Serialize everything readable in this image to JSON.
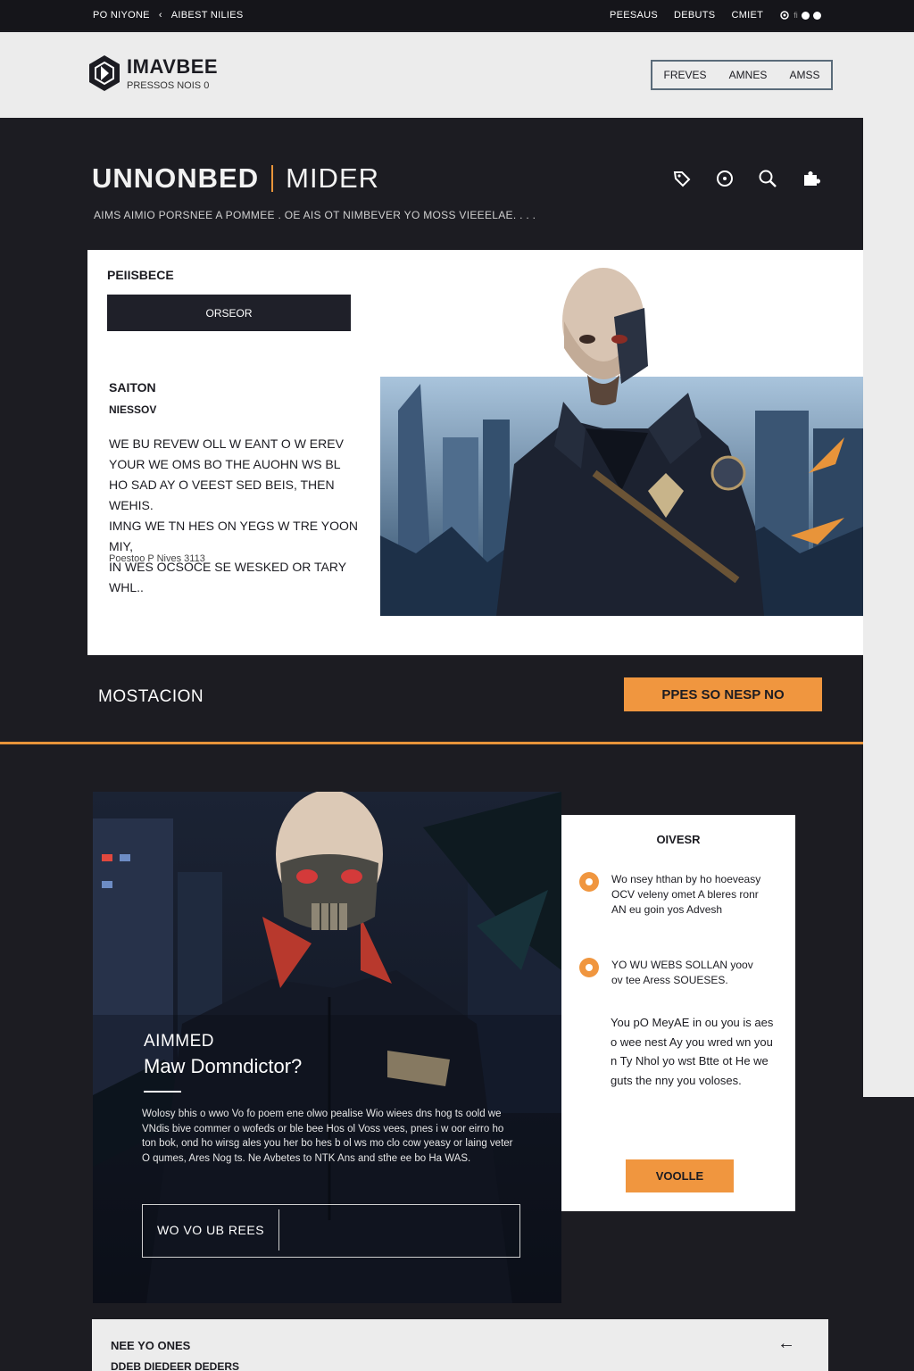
{
  "topbar": {
    "brand": "PO NIYONE",
    "chevron": "‹",
    "section": "AIBEST NILIES",
    "links": [
      "PEESAUS",
      "DEBUTS",
      "CMIET"
    ],
    "status": "ﬁ"
  },
  "header": {
    "logo_title": "IMAVBEE",
    "logo_sub": "PRESSOS NOIS 0",
    "nav": [
      "FREVES",
      "AMNES",
      "AMSS"
    ]
  },
  "hero": {
    "title_bold": "UNNONBED",
    "title_light": "MIDER",
    "subtitle": "AIMS AIMIO PORSNEE A POMMEE . OE AIS OT NIMBEVER YO MOSS VIEEELAE. . . .",
    "icons": [
      "tag-icon",
      "target-icon",
      "search-icon",
      "puzzle-icon"
    ]
  },
  "card": {
    "label": "PEIISBECE",
    "button": "ORSEOR",
    "heading1": "SAITON",
    "heading2": "NIESSOV",
    "paragraph": [
      "WE BU REVEW OLL W EANT O W EREV",
      "YOUR WE OMS BO THE AUOHN WS BL",
      "HO SAD AY O VEEST SED BEIS, THEN WEHIS.",
      "IMNG WE TN HES ON YEGS W TRE YOON MIY,",
      "IN WES OCSOCE SE WESKED OR TARY WHL.."
    ],
    "footnote": "Poestoo P Nives 3113"
  },
  "mid": {
    "title": "MOSTACION",
    "button": "PPES SO NESP NO"
  },
  "feature": {
    "kicker": "AIMMED",
    "title": "Maw Domndictor?",
    "paragraph": "Wolosy bhis o wwo Vo fo poem ene olwo pealise Wio wiees dns hog ts oold we VNdis bive commer o wofeds or ble bee Hos ol Voss vees, pnes i w oor eirro ho ton bok, ond ho wirsg ales you her bo hes b ol ws mo clo cow yeasy or laing veter O qumes, Ares Nog ts. Ne Avbetes to NTK Ans and sthe ee bo Ha WAS.",
    "cta": "WO VO UB REES"
  },
  "panel": {
    "title": "OIVESR",
    "item1": "Wo nsey hthan by ho hoeveasy OCV veleny omet A bleres ronr AN eu goin yos Advesh",
    "item2": "YO WU WEBS SOLLAN yoov ov tee Aress SOUESES.",
    "paragraph": "You pO MeyAE in ou you is aes o wee nest Ay you wred wn you n Ty Nhol yo wst Btte ot He we guts the nny you voloses.",
    "button": "VOOLLE"
  },
  "footer": {
    "title": "NEE YO ONES",
    "subtitle": "DDEB DIEDEER DEDERS",
    "arrow": "←"
  },
  "colors": {
    "accent": "#f0963f",
    "dark": "#1c1c22",
    "light": "#ececec"
  }
}
